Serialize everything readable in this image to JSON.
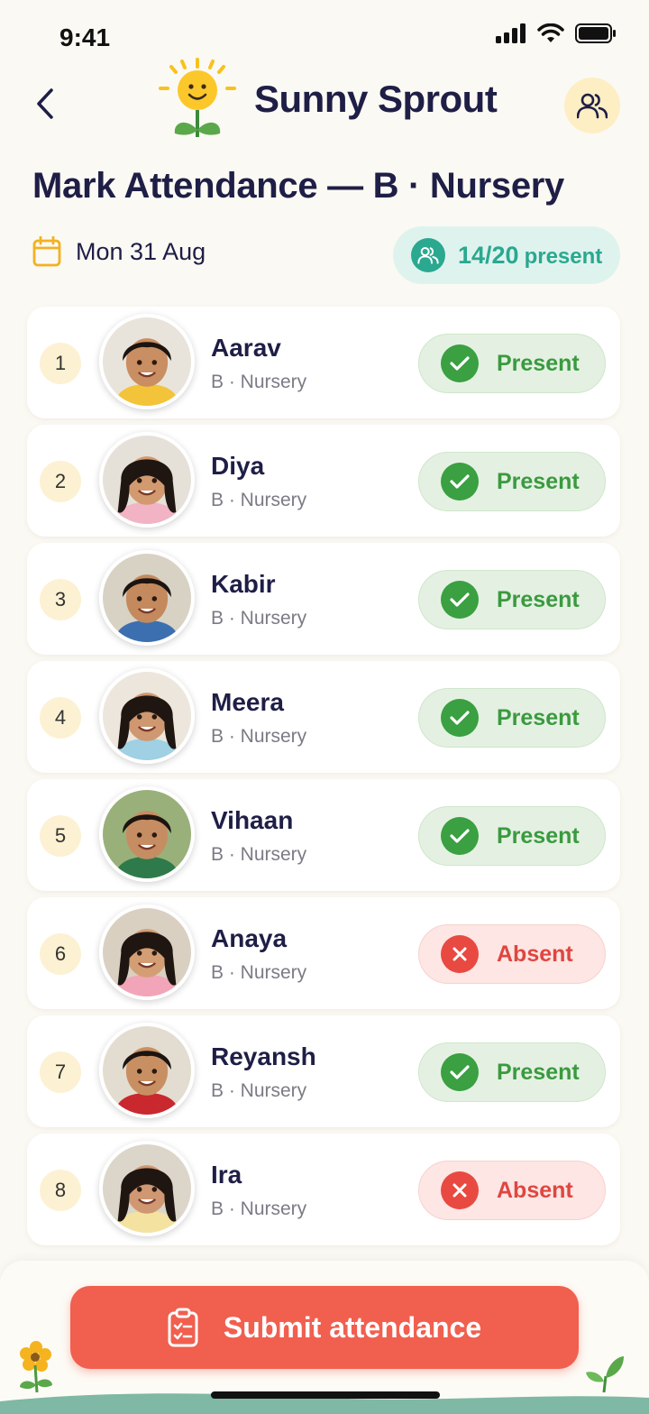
{
  "status_bar": {
    "time": "9:41"
  },
  "header": {
    "app_name": "Sunny Sprout",
    "back_icon": "chevron-left-icon",
    "group_icon": "people-icon"
  },
  "page": {
    "title": "Mark Attendance — B · Nursery",
    "date": "Mon 31 Aug",
    "present_count": "14/20",
    "present_word": "present"
  },
  "students": [
    {
      "num": "1",
      "name": "Aarav",
      "class": "B · Nursery",
      "status": "present",
      "status_label": "Present"
    },
    {
      "num": "2",
      "name": "Diya",
      "class": "B · Nursery",
      "status": "present",
      "status_label": "Present"
    },
    {
      "num": "3",
      "name": "Kabir",
      "class": "B · Nursery",
      "status": "present",
      "status_label": "Present"
    },
    {
      "num": "4",
      "name": "Meera",
      "class": "B · Nursery",
      "status": "present",
      "status_label": "Present"
    },
    {
      "num": "5",
      "name": "Vihaan",
      "class": "B · Nursery",
      "status": "present",
      "status_label": "Present"
    },
    {
      "num": "6",
      "name": "Anaya",
      "class": "B · Nursery",
      "status": "absent",
      "status_label": "Absent"
    },
    {
      "num": "7",
      "name": "Reyansh",
      "class": "B · Nursery",
      "status": "present",
      "status_label": "Present"
    },
    {
      "num": "8",
      "name": "Ira",
      "class": "B · Nursery",
      "status": "absent",
      "status_label": "Absent"
    }
  ],
  "submit": {
    "label": "Submit attendance",
    "icon": "clipboard-check-icon"
  },
  "colors": {
    "accent": "#f15f4f",
    "present": "#3aa041",
    "absent": "#e84a42",
    "teal": "#2aa890"
  }
}
